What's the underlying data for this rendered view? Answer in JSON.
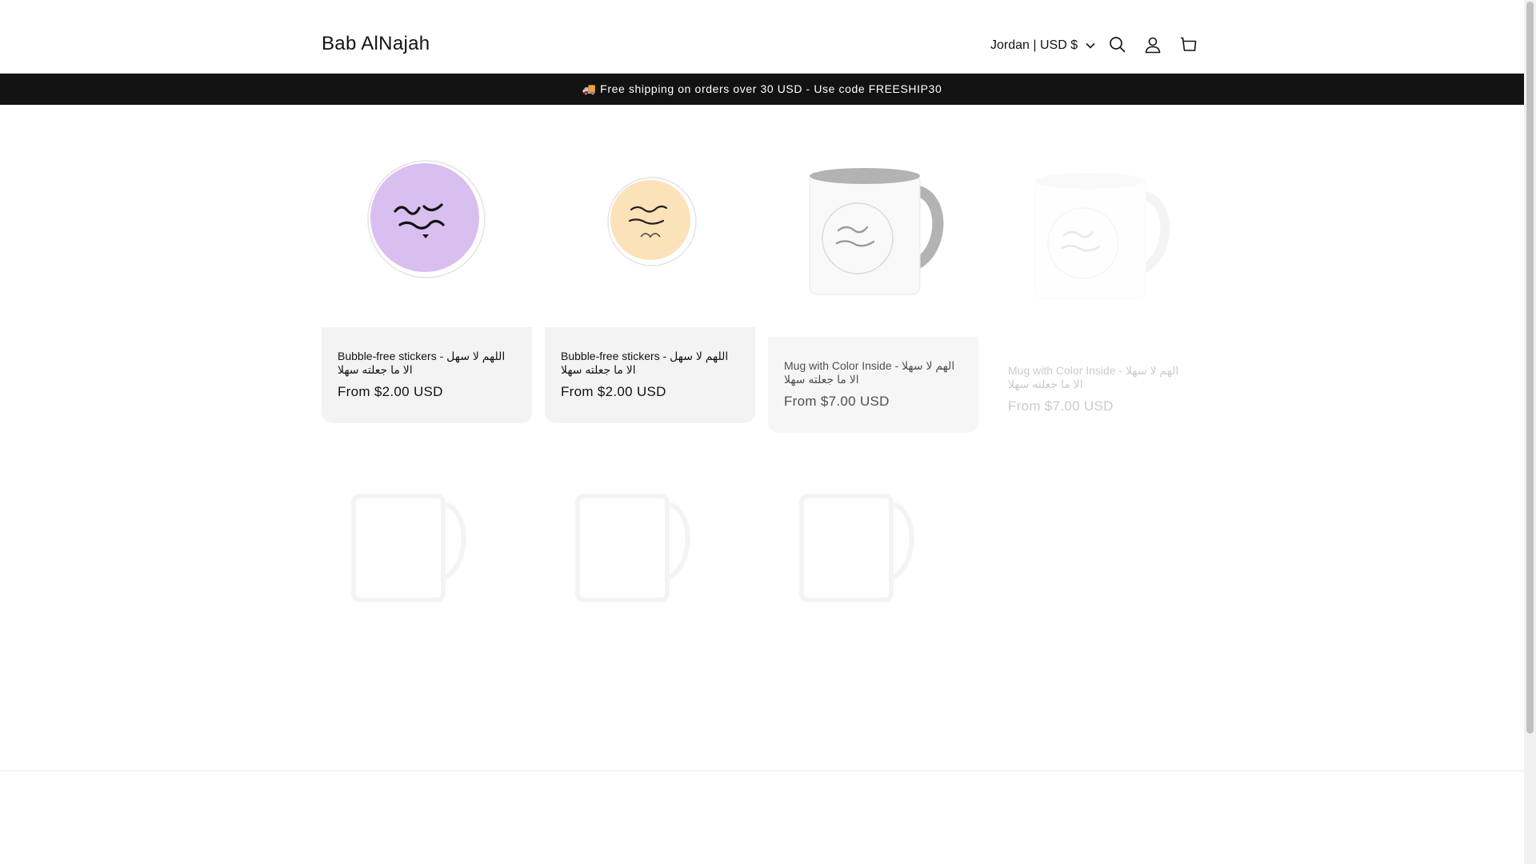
{
  "header": {
    "logo": "Bab AlNajah",
    "locale": "Jordan | USD $",
    "icons": [
      "chevron-down-icon",
      "search-icon",
      "account-icon",
      "cart-icon"
    ]
  },
  "announcement": "🚚 Free shipping on orders over 30 USD - Use code FREESHIP30",
  "products": [
    {
      "title": "Bubble-free stickers - اللهم لا سهل الا ما جعلته سهلا",
      "price": "From $2.00 USD",
      "image": "purple-round-sticker"
    },
    {
      "title": "Bubble-free stickers - اللهم لا سهل الا ما جعلته سهلا",
      "price": "From $2.00 USD",
      "image": "peach-round-sticker"
    },
    {
      "title": "Mug with Color Inside - الهم لا سهلا الا ما جعلته سهلا",
      "price": "From $7.00 USD",
      "image": "grey-inside-mug"
    },
    {
      "title": "Mug with Color Inside - الهم لا سهلا الا ما جعلته سهلا",
      "price": "From $7.00 USD",
      "image": "white-mug"
    }
  ],
  "colors": {
    "announcement_bg": "#121212",
    "card_bg": "#f3f3f3",
    "sticker_purple": "#d9bff0",
    "sticker_peach": "#fbe2b8",
    "mug_inner": "#9a9a9a"
  }
}
